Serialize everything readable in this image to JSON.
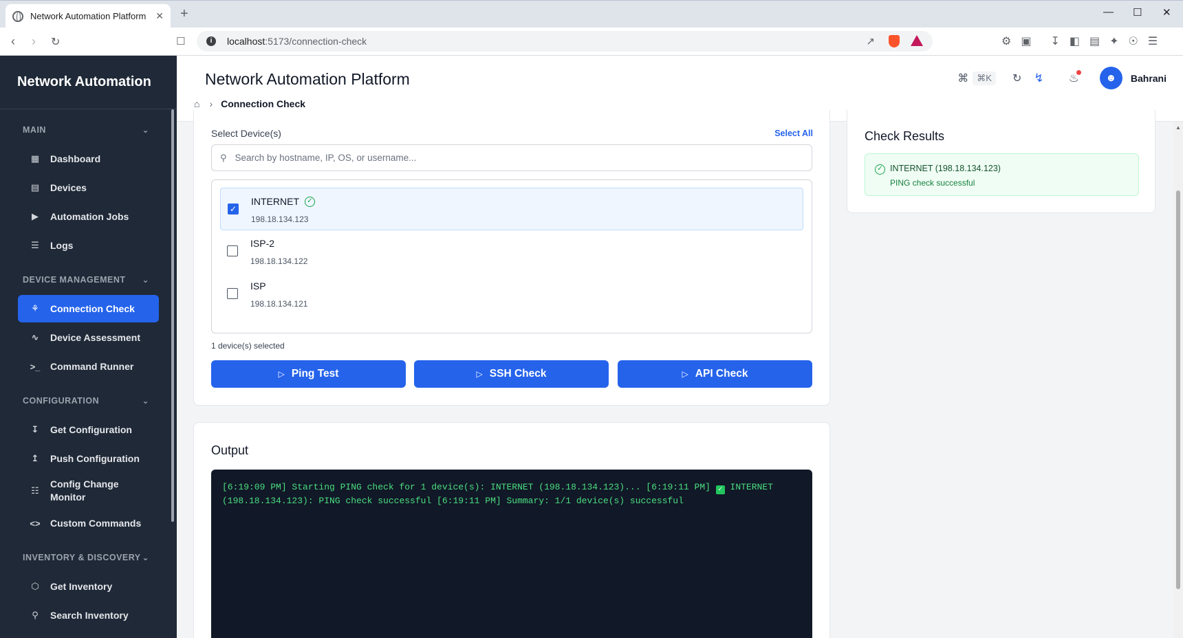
{
  "browser": {
    "tab_title": "Network Automation Platform",
    "new_tab": "+",
    "tab_close": "✕",
    "url_host": "localhost",
    "url_path": ":5173/connection-check",
    "min": "—",
    "max": "☐",
    "close": "✕"
  },
  "sidebar": {
    "brand": "Network Automation",
    "sections": [
      {
        "title": "MAIN",
        "items": [
          "Dashboard",
          "Devices",
          "Automation Jobs",
          "Logs"
        ]
      },
      {
        "title": "DEVICE MANAGEMENT",
        "items": [
          "Connection Check",
          "Device Assessment",
          "Command Runner"
        ]
      },
      {
        "title": "CONFIGURATION",
        "items": [
          "Get Configuration",
          "Push Configuration",
          "Config Change Monitor",
          "Custom Commands"
        ]
      },
      {
        "title": "INVENTORY & DISCOVERY",
        "items": [
          "Get Inventory",
          "Search Inventory"
        ]
      }
    ],
    "active_item": "Connection Check"
  },
  "header": {
    "title": "Network Automation Platform",
    "breadcrumb_current": "Connection Check",
    "shortcut_hint": "⌘K",
    "user_name": "Bahrani"
  },
  "devices_panel": {
    "label": "Select Device(s)",
    "select_all": "Select All",
    "search_placeholder": "Search by hostname, IP, OS, or username...",
    "devices": [
      {
        "name": "INTERNET",
        "ip": "198.18.134.123",
        "selected": true,
        "verified": true
      },
      {
        "name": "ISP-2",
        "ip": "198.18.134.122",
        "selected": false,
        "verified": false
      },
      {
        "name": "ISP",
        "ip": "198.18.134.121",
        "selected": false,
        "verified": false
      }
    ],
    "selected_count": "1 device(s) selected",
    "buttons": [
      "Ping Test",
      "SSH Check",
      "API Check"
    ]
  },
  "output": {
    "title": "Output",
    "text_before_check": "[6:19:09 PM] Starting PING check for 1 device(s): INTERNET (198.18.134.123)... [6:19:11 PM] ",
    "text_after_check": " INTERNET (198.18.134.123): PING check successful [6:19:11 PM] Summary: 1/1 device(s) successful"
  },
  "results": {
    "title": "Check Results",
    "items": [
      {
        "name": "INTERNET (198.18.134.123)",
        "message": "PING check successful"
      }
    ]
  },
  "colors": {
    "primary": "#2563eb",
    "sidebar_bg": "#1f2937",
    "success": "#16a34a",
    "terminal_bg": "#111827",
    "terminal_text": "#4ade80"
  }
}
